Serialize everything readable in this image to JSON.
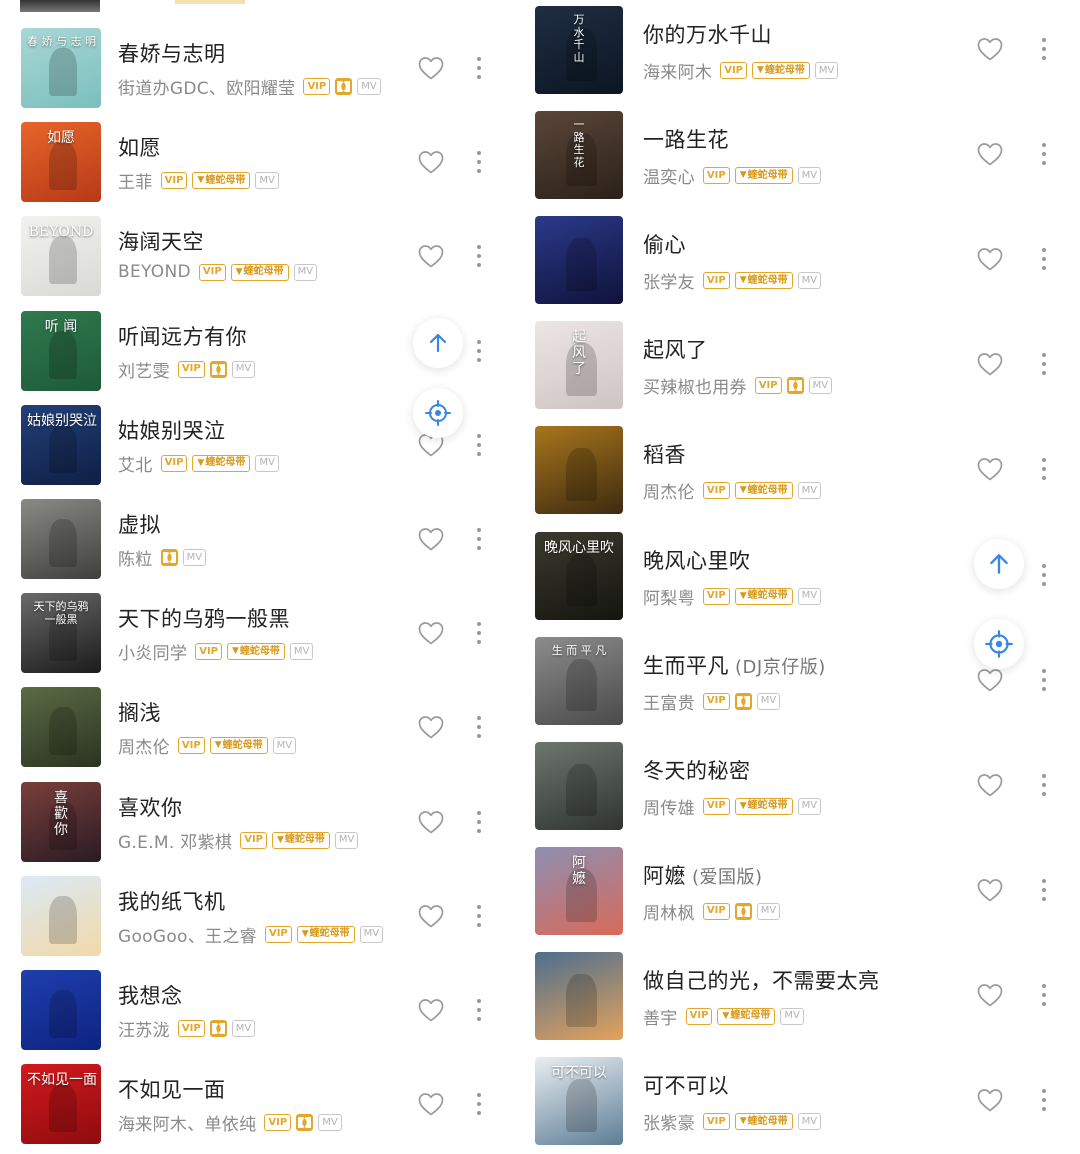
{
  "left_list": [
    {
      "title": "春娇与志明",
      "artist": "街道办GDC、欧阳耀莹",
      "tags": [
        "VIP",
        "DOLBY",
        "MV"
      ],
      "cover_text": "春 娇 与 志 明",
      "cover_colors": [
        "#a9d7d6",
        "#7bbfbd"
      ]
    },
    {
      "title": "如愿",
      "artist": "王菲",
      "tags": [
        "VIP",
        "蝰蛇母带",
        "MV"
      ],
      "cover_text": "如愿",
      "cover_colors": [
        "#e8642a",
        "#b63a17"
      ]
    },
    {
      "title": "海阔天空",
      "artist": "BEYOND",
      "tags": [
        "VIP",
        "蝰蛇母带",
        "MV"
      ],
      "cover_text": "BEYOND",
      "cover_colors": [
        "#f2f2f0",
        "#d9d9d6"
      ]
    },
    {
      "title": "听闻远方有你",
      "artist": "刘艺雯",
      "tags": [
        "VIP",
        "DOLBY",
        "MV"
      ],
      "cover_text": "听 闻",
      "cover_colors": [
        "#2f7a4e",
        "#1e5a38"
      ]
    },
    {
      "title": "姑娘别哭泣",
      "artist": "艾北",
      "tags": [
        "VIP",
        "蝰蛇母带",
        "MV"
      ],
      "cover_text": "姑娘别哭泣",
      "cover_colors": [
        "#23407a",
        "#0f1f44"
      ]
    },
    {
      "title": "虚拟",
      "artist": "陈粒",
      "tags": [
        "DOLBY",
        "MV"
      ],
      "cover_text": "",
      "cover_colors": [
        "#8a8a86",
        "#3f3f3d"
      ]
    },
    {
      "title": "天下的乌鸦一般黑",
      "artist": "小炎同学",
      "tags": [
        "VIP",
        "蝰蛇母带",
        "MV"
      ],
      "cover_text": "天下的乌鸦\n一般黑",
      "cover_colors": [
        "#6a6a6a",
        "#1b1b1b"
      ]
    },
    {
      "title": "搁浅",
      "artist": "周杰伦",
      "tags": [
        "VIP",
        "蝰蛇母带",
        "MV"
      ],
      "cover_text": "",
      "cover_colors": [
        "#5b6b45",
        "#2b3320"
      ]
    },
    {
      "title": "喜欢你",
      "artist": "G.E.M. 邓紫棋",
      "tags": [
        "VIP",
        "蝰蛇母带",
        "MV"
      ],
      "cover_text": "喜\n歡\n你",
      "cover_colors": [
        "#7a3f3a",
        "#2a1b24"
      ]
    },
    {
      "title": "我的纸飞机",
      "artist": "GooGoo、王之睿",
      "tags": [
        "VIP",
        "蝰蛇母带",
        "MV"
      ],
      "cover_text": "",
      "cover_colors": [
        "#dbe9f6",
        "#f2d9a8"
      ]
    },
    {
      "title": "我想念",
      "artist": "汪苏泷",
      "tags": [
        "VIP",
        "DOLBY",
        "MV"
      ],
      "cover_text": "",
      "cover_colors": [
        "#1f3fae",
        "#0d2380"
      ]
    },
    {
      "title": "不如见一面",
      "artist": "海来阿木、单依纯",
      "tags": [
        "VIP",
        "DOLBY",
        "MV"
      ],
      "cover_text": "不如见一面",
      "cover_colors": [
        "#d4191c",
        "#8d0c10"
      ]
    }
  ],
  "right_list": [
    {
      "title": "你的万水千山",
      "subtitle": "",
      "artist": "海来阿木",
      "tags": [
        "VIP",
        "蝰蛇母带",
        "MV"
      ],
      "cover_text": "万\n水\n千\n山",
      "cover_colors": [
        "#1f2e44",
        "#0c1522"
      ]
    },
    {
      "title": "一路生花",
      "subtitle": "",
      "artist": "温奕心",
      "tags": [
        "VIP",
        "蝰蛇母带",
        "MV"
      ],
      "cover_text": "一\n路\n生\n花",
      "cover_colors": [
        "#5a4638",
        "#2b211a"
      ]
    },
    {
      "title": "偷心",
      "subtitle": "",
      "artist": "张学友",
      "tags": [
        "VIP",
        "蝰蛇母带",
        "MV"
      ],
      "cover_text": "",
      "cover_colors": [
        "#2b3a8a",
        "#0f123a"
      ]
    },
    {
      "title": "起风了",
      "subtitle": "",
      "artist": "买辣椒也用券",
      "tags": [
        "VIP",
        "DOLBY",
        "MV"
      ],
      "cover_text": "起\n风\n了",
      "cover_colors": [
        "#ece6e4",
        "#cfc3c3"
      ]
    },
    {
      "title": "稻香",
      "subtitle": "",
      "artist": "周杰伦",
      "tags": [
        "VIP",
        "蝰蛇母带",
        "MV"
      ],
      "cover_text": "",
      "cover_colors": [
        "#a8761d",
        "#3e2a10"
      ]
    },
    {
      "title": "晚风心里吹",
      "subtitle": "",
      "artist": "阿梨粤",
      "tags": [
        "VIP",
        "蝰蛇母带",
        "MV"
      ],
      "cover_text": "晚风心里吹",
      "cover_colors": [
        "#3a3a2e",
        "#151510"
      ]
    },
    {
      "title": "生而平凡",
      "subtitle": "(DJ京仔版)",
      "artist": "王富贵",
      "tags": [
        "VIP",
        "DOLBY",
        "MV"
      ],
      "cover_text": "生 而 平 凡",
      "cover_colors": [
        "#8c8c8c",
        "#4a4a4a"
      ]
    },
    {
      "title": "冬天的秘密",
      "subtitle": "",
      "artist": "周传雄",
      "tags": [
        "VIP",
        "蝰蛇母带",
        "MV"
      ],
      "cover_text": "",
      "cover_colors": [
        "#6e7670",
        "#2f3431"
      ]
    },
    {
      "title": "阿嬷",
      "subtitle": "(爱国版)",
      "artist": "周林枫",
      "tags": [
        "VIP",
        "DOLBY",
        "MV"
      ],
      "cover_text": "阿\n嬷",
      "cover_colors": [
        "#8c8fb2",
        "#d96a5a"
      ]
    },
    {
      "title": "做自己的光，不需要太亮",
      "subtitle": "",
      "artist": "善宇",
      "tags": [
        "VIP",
        "蝰蛇母带",
        "MV"
      ],
      "cover_text": "",
      "cover_colors": [
        "#4d6e8e",
        "#e3a25c"
      ]
    },
    {
      "title": "可不可以",
      "subtitle": "",
      "artist": "张紫豪",
      "tags": [
        "VIP",
        "蝰蛇母带",
        "MV"
      ],
      "cover_text": "可不可以",
      "cover_colors": [
        "#e9eef2",
        "#5d7d95"
      ]
    }
  ],
  "icons": {
    "favorite": "heart-outline-icon",
    "more": "vertical-dots-icon",
    "scroll_top": "arrow-up-icon",
    "locate": "crosshair-icon"
  },
  "colors": {
    "accent_gold": "#e3a72c",
    "float_blue": "#3a86e6",
    "text_primary": "#222222",
    "text_secondary": "#8a8a8a"
  }
}
